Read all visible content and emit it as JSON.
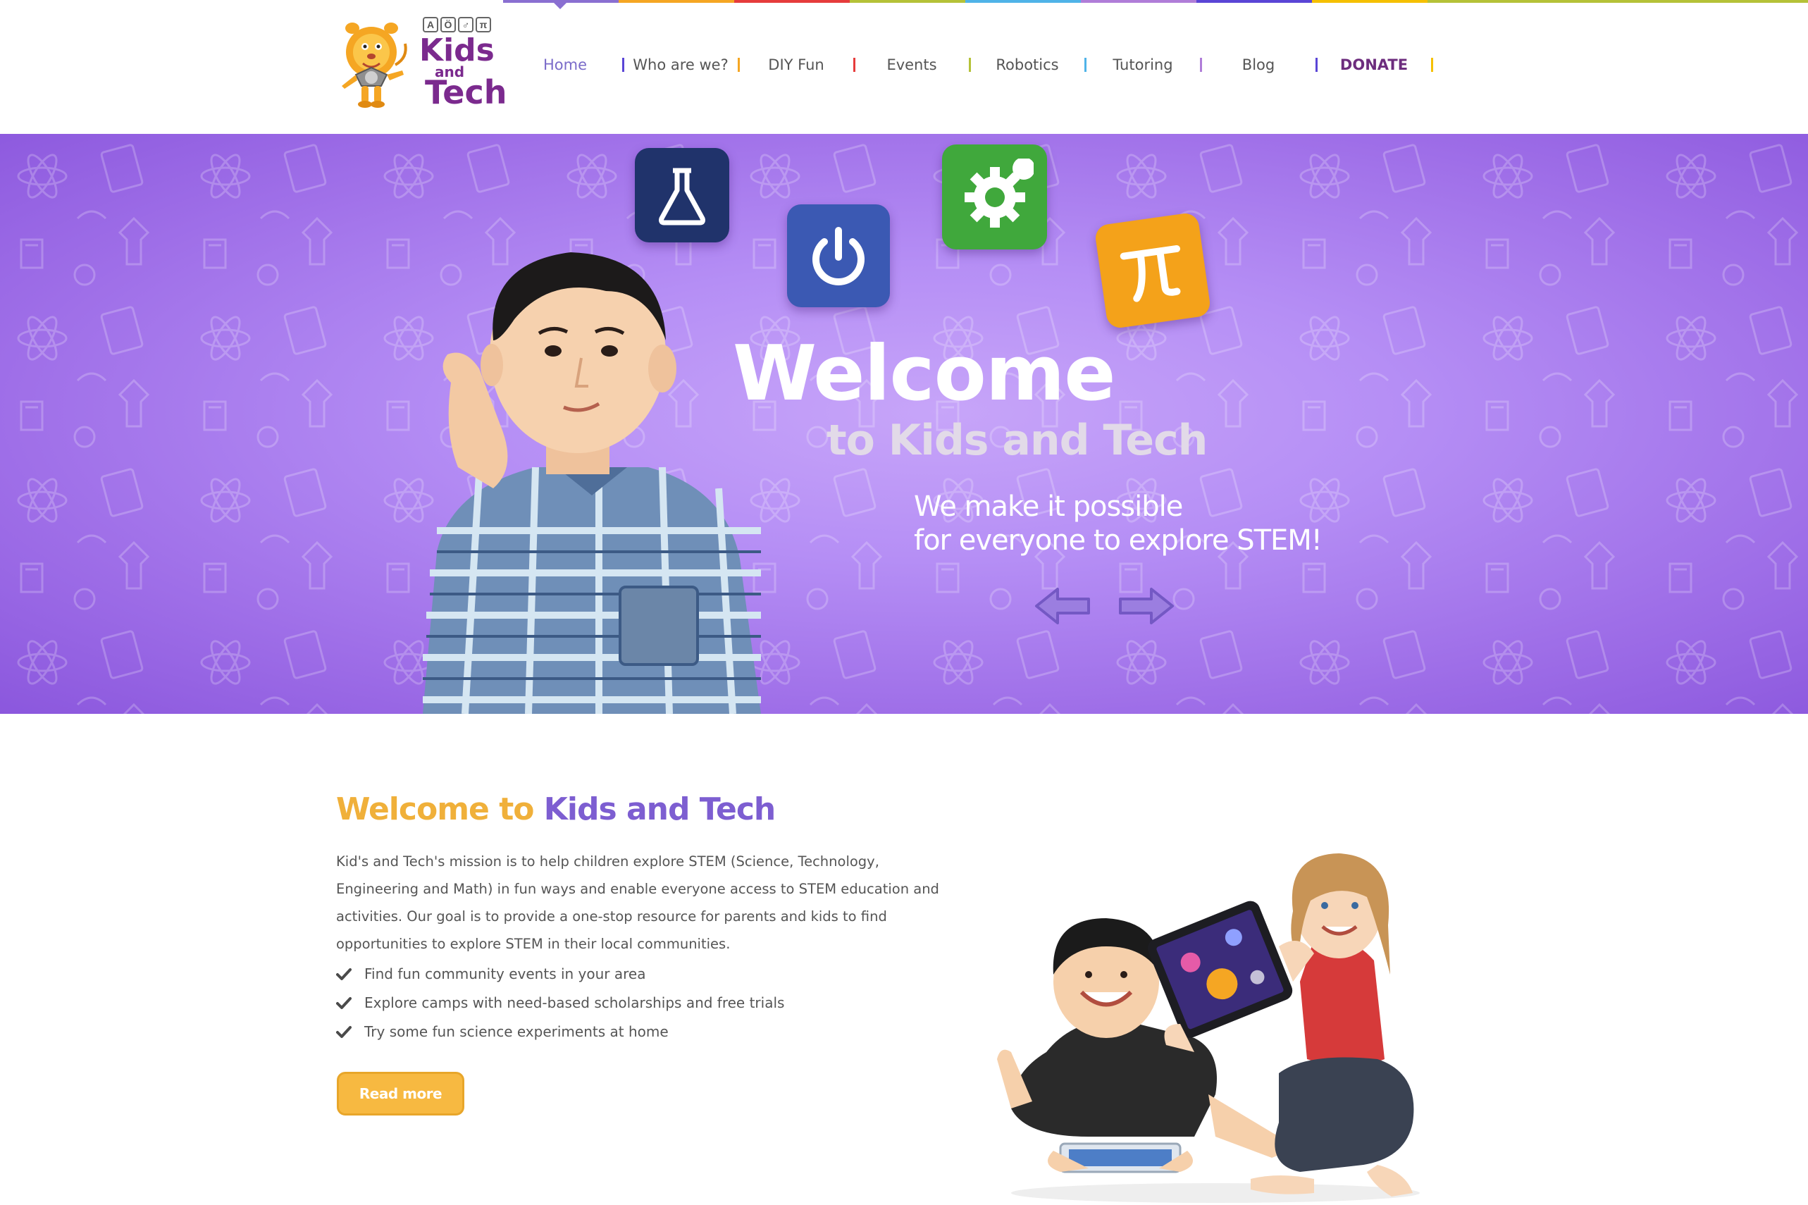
{
  "brand": {
    "logo_words": [
      "Kids",
      "and",
      "Tech"
    ],
    "logo_badges": [
      "A",
      "Ö",
      "♂",
      "π"
    ]
  },
  "nav": {
    "items": [
      {
        "label": "Home",
        "active": true
      },
      {
        "label": "Who are we?"
      },
      {
        "label": "DIY Fun"
      },
      {
        "label": "Events"
      },
      {
        "label": "Robotics"
      },
      {
        "label": "Tutoring"
      },
      {
        "label": "Blog"
      },
      {
        "label": "DONATE"
      }
    ],
    "separator_colors": [
      "#5a45d6",
      "#f5a623",
      "#e63c3c",
      "#b5c238",
      "#4fb3e8",
      "#b07dd8",
      "#5a45d6",
      "#f5c000"
    ]
  },
  "hero": {
    "title": "Welcome",
    "subtitle": "to Kids and Tech",
    "tagline_line1": "We make it possible",
    "tagline_line2": "for everyone to explore STEM!",
    "icons": [
      "flask-icon",
      "power-icon",
      "gear-icon",
      "pi-icon"
    ]
  },
  "about": {
    "heading_part1": "Welcome to",
    "heading_part2": "Kids and Tech",
    "body": "Kid's and Tech's mission is to help children explore STEM (Science, Technology, Engineering and Math) in fun ways and enable everyone access to STEM education and activities. Our goal is to provide a one-stop resource for parents and kids to find opportunities to explore STEM in their local communities.",
    "list": [
      "Find fun community events in your area",
      "Explore camps with need-based scholarships and free trials",
      "Try some fun science experiments at home"
    ],
    "cta": "Read more"
  },
  "colors": {
    "accent_yellow": "#f7b941",
    "accent_purple": "#7d5ed1",
    "hero_purple": "#b58ef5"
  }
}
